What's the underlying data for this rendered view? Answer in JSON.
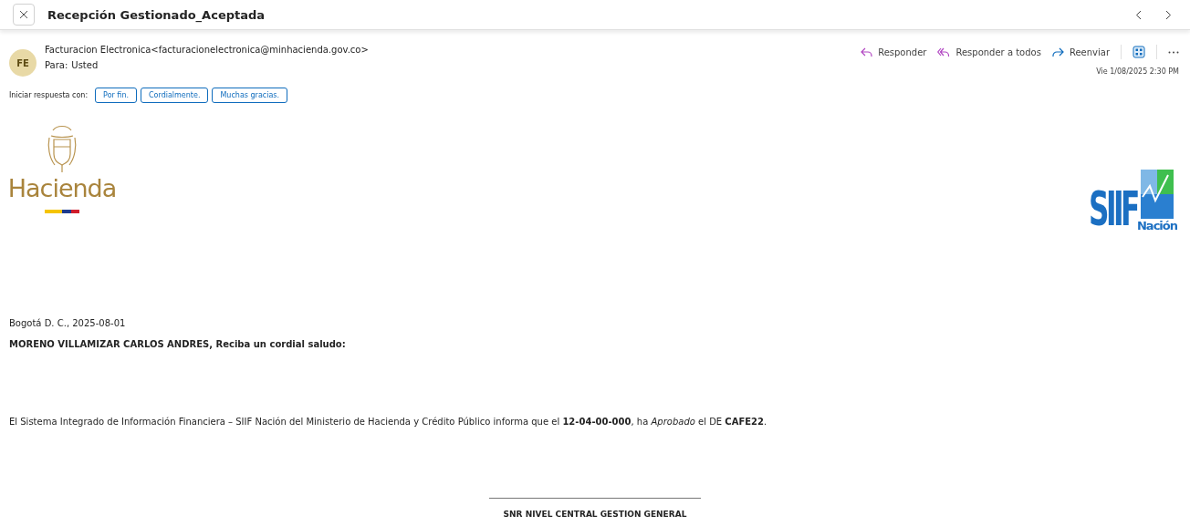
{
  "header": {
    "title": "Recepción Gestionado_Aceptada"
  },
  "sender": {
    "initials": "FE",
    "from": "Facturacion Electronica<facturacionelectronica@minhacienda.gov.co>",
    "to_label": "Para:",
    "to": "Usted",
    "date": "Vie 1/08/2025 2:30 PM"
  },
  "actions": [
    {
      "kind": "reply",
      "label": "Responder"
    },
    {
      "kind": "reply_all",
      "label": "Responder a todos"
    },
    {
      "kind": "forward",
      "label": "Reenviar"
    }
  ],
  "quick_replies": {
    "label": "Iniciar respuesta con:",
    "options": [
      "Por fin.",
      "Cordialmente.",
      "Muchas gracias."
    ]
  },
  "logos": {
    "left": "Hacienda",
    "right_main": "SIIF",
    "right_sub": "Nación"
  },
  "body": {
    "place_date": "Bogotá D. C., 2025-08-01",
    "greeting": "MORENO VILLAMIZAR CARLOS ANDRES, Reciba un cordial saludo:",
    "message": "El Sistema Integrado de Información Financiera – SIIF Nación del Ministerio de Hacienda y Crédito Público informa que el **12-04-00-000**, ha *Aprobado* el DE **CAFE22**.",
    "signature": "SNR NIVEL CENTRAL GESTION GENERAL"
  }
}
